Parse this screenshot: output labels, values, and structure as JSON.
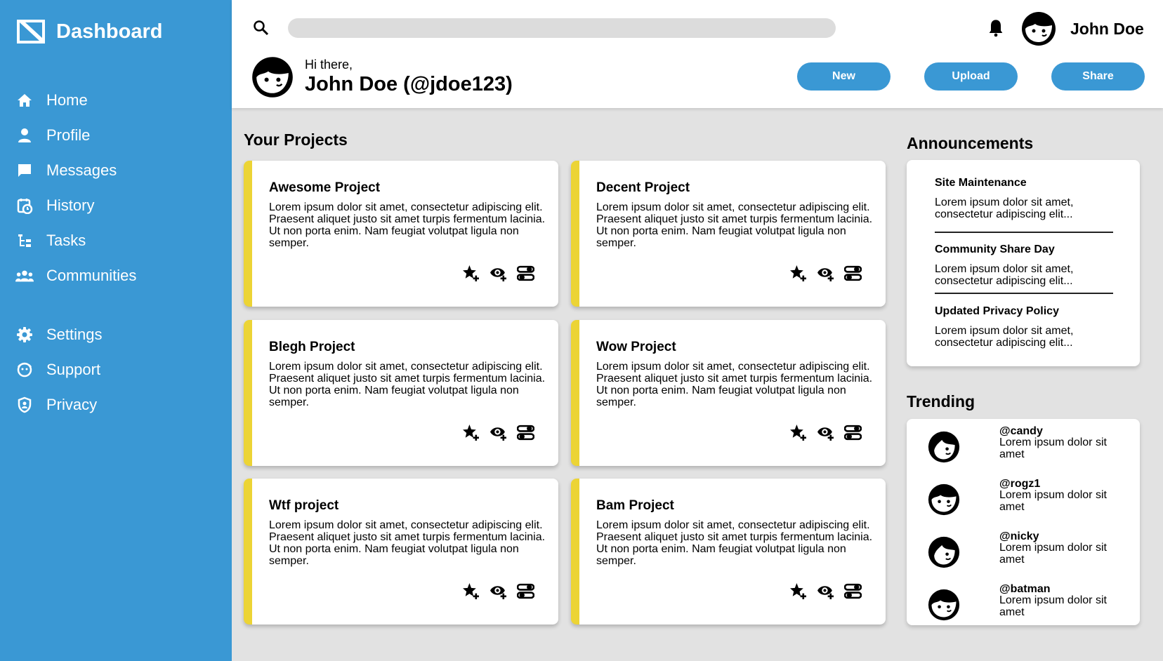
{
  "app": {
    "title": "Dashboard"
  },
  "colors": {
    "primary": "#3a98d4",
    "accent": "#ecd435",
    "background": "#e2e2e2"
  },
  "sidebar": {
    "primary_items": [
      {
        "label": "Home",
        "icon": "home-icon"
      },
      {
        "label": "Profile",
        "icon": "person-icon"
      },
      {
        "label": "Messages",
        "icon": "chat-icon"
      },
      {
        "label": "History",
        "icon": "history-icon"
      },
      {
        "label": "Tasks",
        "icon": "tasks-icon"
      },
      {
        "label": "Communities",
        "icon": "group-icon"
      }
    ],
    "secondary_items": [
      {
        "label": "Settings",
        "icon": "gear-icon"
      },
      {
        "label": "Support",
        "icon": "support-icon"
      },
      {
        "label": "Privacy",
        "icon": "shield-icon"
      }
    ]
  },
  "header": {
    "search": {
      "placeholder": "",
      "value": ""
    },
    "user_name": "John Doe",
    "greeting": "Hi there,",
    "full_name": "John Doe (@jdoe123)",
    "buttons": {
      "new": "New",
      "upload": "Upload",
      "share": "Share"
    }
  },
  "projects": {
    "title": "Your Projects",
    "items": [
      {
        "title": "Awesome Project",
        "description": "Lorem ipsum dolor sit amet, consectetur adipiscing elit. Praesent aliquet justo sit amet turpis fermentum lacinia. Ut non porta enim. Nam feugiat volutpat ligula non semper."
      },
      {
        "title": "Decent Project",
        "description": "Lorem ipsum dolor sit amet, consectetur adipiscing elit. Praesent aliquet justo sit amet turpis fermentum lacinia. Ut non porta enim. Nam feugiat volutpat ligula non semper."
      },
      {
        "title": "Blegh Project",
        "description": "Lorem ipsum dolor sit amet, consectetur adipiscing elit. Praesent aliquet justo sit amet turpis fermentum lacinia. Ut non porta enim. Nam feugiat volutpat ligula non semper."
      },
      {
        "title": "Wow Project",
        "description": "Lorem ipsum dolor sit amet, consectetur adipiscing elit. Praesent aliquet justo sit amet turpis fermentum lacinia. Ut non porta enim. Nam feugiat volutpat ligula non semper."
      },
      {
        "title": "Wtf project",
        "description": "Lorem ipsum dolor sit amet, consectetur adipiscing elit. Praesent aliquet justo sit amet turpis fermentum lacinia. Ut non porta enim. Nam feugiat volutpat ligula non semper."
      },
      {
        "title": "Bam Project",
        "description": "Lorem ipsum dolor sit amet, consectetur adipiscing elit. Praesent aliquet justo sit amet turpis fermentum lacinia. Ut non porta enim. Nam feugiat volutpat ligula non semper."
      }
    ],
    "action_icons": [
      "star-add-icon",
      "watch-add-icon",
      "share-toggle-icon"
    ]
  },
  "announcements": {
    "title": "Announcements",
    "items": [
      {
        "title": "Site Maintenance",
        "text": "Lorem ipsum dolor sit amet, consectetur adipiscing elit..."
      },
      {
        "title": "Community Share Day",
        "text": "Lorem ipsum dolor sit amet, consectetur adipiscing elit..."
      },
      {
        "title": "Updated Privacy Policy",
        "text": "Lorem ipsum dolor sit amet, consectetur adipiscing elit..."
      }
    ]
  },
  "trending": {
    "title": "Trending",
    "items": [
      {
        "handle": "@candy",
        "text": "Lorem ipsum dolor sit amet"
      },
      {
        "handle": "@rogz1",
        "text": "Lorem ipsum dolor sit amet"
      },
      {
        "handle": "@nicky",
        "text": "Lorem ipsum dolor sit amet"
      },
      {
        "handle": "@batman",
        "text": "Lorem ipsum dolor sit amet"
      }
    ]
  }
}
